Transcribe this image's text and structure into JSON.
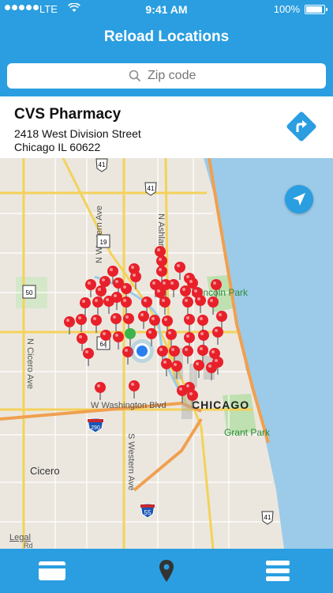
{
  "status": {
    "carrier": "LTE",
    "time": "9:41 AM",
    "battery": "100%",
    "battery_level": 1.0
  },
  "header": {
    "title": "Reload Locations"
  },
  "search": {
    "placeholder": "Zip code"
  },
  "location": {
    "name": "CVS Pharmacy",
    "street": "2418 West Division Street",
    "city": "Chicago IL 60622"
  },
  "map": {
    "labels": {
      "n_western": "N Western Ave",
      "n_ashland": "N Ashland Ave",
      "n_cicero": "N Cicero Ave",
      "w_washington": "W Washington Blvd",
      "s_western": "S Western Ave",
      "cicero": "Cicero",
      "chicago": "CHICAGO",
      "lincoln_park": "Lincoln Park",
      "grant_park": "Grant Park",
      "legal": "Legal",
      "legal2": "Rd"
    },
    "shields": {
      "us41_top": "41",
      "us41_mid": "41",
      "il19": "19",
      "il50": "50",
      "il64": "64",
      "i290": "290",
      "i55": "55",
      "us41_bottom": "41"
    }
  },
  "tabs": [
    "card-icon",
    "pin-icon",
    "menu-icon"
  ],
  "colors": {
    "accent": "#2a9ee0",
    "pin": "#e8202a",
    "selected_pin": "#3bb54a"
  }
}
